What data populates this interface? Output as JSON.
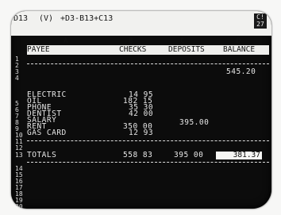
{
  "status_bar": {
    "cell_ref": "D13",
    "format": "(V)",
    "formula": "+D3-B13+C13",
    "indicator_top": "C!",
    "indicator_bottom": "27"
  },
  "column_letters": [
    "A",
    "B",
    "C",
    "D"
  ],
  "columns": {
    "payee": "PAYEE",
    "checks": "CHECKS",
    "deposits": "DEPOSITS",
    "balance": "BALANCE"
  },
  "row_numbers": [
    "1",
    "2",
    "3",
    "4",
    "5",
    "6",
    "7",
    "8",
    "9",
    "10",
    "11",
    "12",
    "13",
    "14",
    "15",
    "16",
    "17",
    "18",
    "19",
    "20"
  ],
  "opening_balance": "545.20",
  "rows": [
    {
      "payee": "ELECTRIC",
      "checks": "14 95",
      "deposits": ""
    },
    {
      "payee": "OIL",
      "checks": "182 15",
      "deposits": ""
    },
    {
      "payee": "PHONE",
      "checks": "35 30",
      "deposits": ""
    },
    {
      "payee": "DENTIST",
      "checks": "42 00",
      "deposits": ""
    },
    {
      "payee": "SALARY",
      "checks": "",
      "deposits": "395.00"
    },
    {
      "payee": "RENT",
      "checks": "350 00",
      "deposits": ""
    },
    {
      "payee": "GAS CARD",
      "checks": "12 93",
      "deposits": ""
    }
  ],
  "totals": {
    "label": "TOTALS",
    "checks": "558 83",
    "deposits": "395 00",
    "balance": "381.37"
  }
}
